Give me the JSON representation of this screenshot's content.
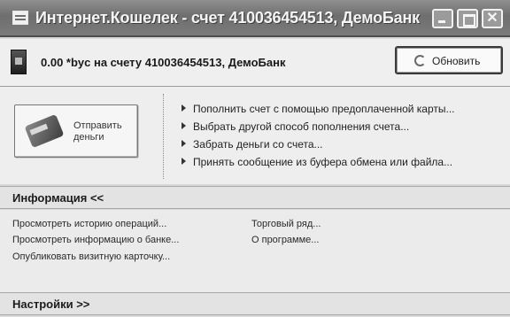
{
  "window": {
    "title": "Интернет.Кошелек - счет 410036454513, ДемоБанк",
    "close_glyph": "✕"
  },
  "account_bar": {
    "balance_text": "0.00 *byc на счету  410036454513, ДемоБанк",
    "refresh_label": "Обновить"
  },
  "send_button": {
    "label_line1": "Отправить",
    "label_line2": "деньги"
  },
  "actions": [
    {
      "label": "Пополнить счет с помощью предоплаченной карты..."
    },
    {
      "label": "Выбрать другой способ пополнения счета..."
    },
    {
      "label": "Забрать деньги со счета..."
    },
    {
      "label": "Принять сообщение из буфера обмена или файла..."
    }
  ],
  "info_section": {
    "header": "Информация <<",
    "links": {
      "history": "Просмотреть историю операций...",
      "bank_info": "Просмотреть информацию о банке...",
      "publish_card": "Опубликовать визитную карточку...",
      "trade_row": "Торговый ряд...",
      "about": "О программе..."
    }
  },
  "settings_section": {
    "header": "Настройки >>"
  }
}
